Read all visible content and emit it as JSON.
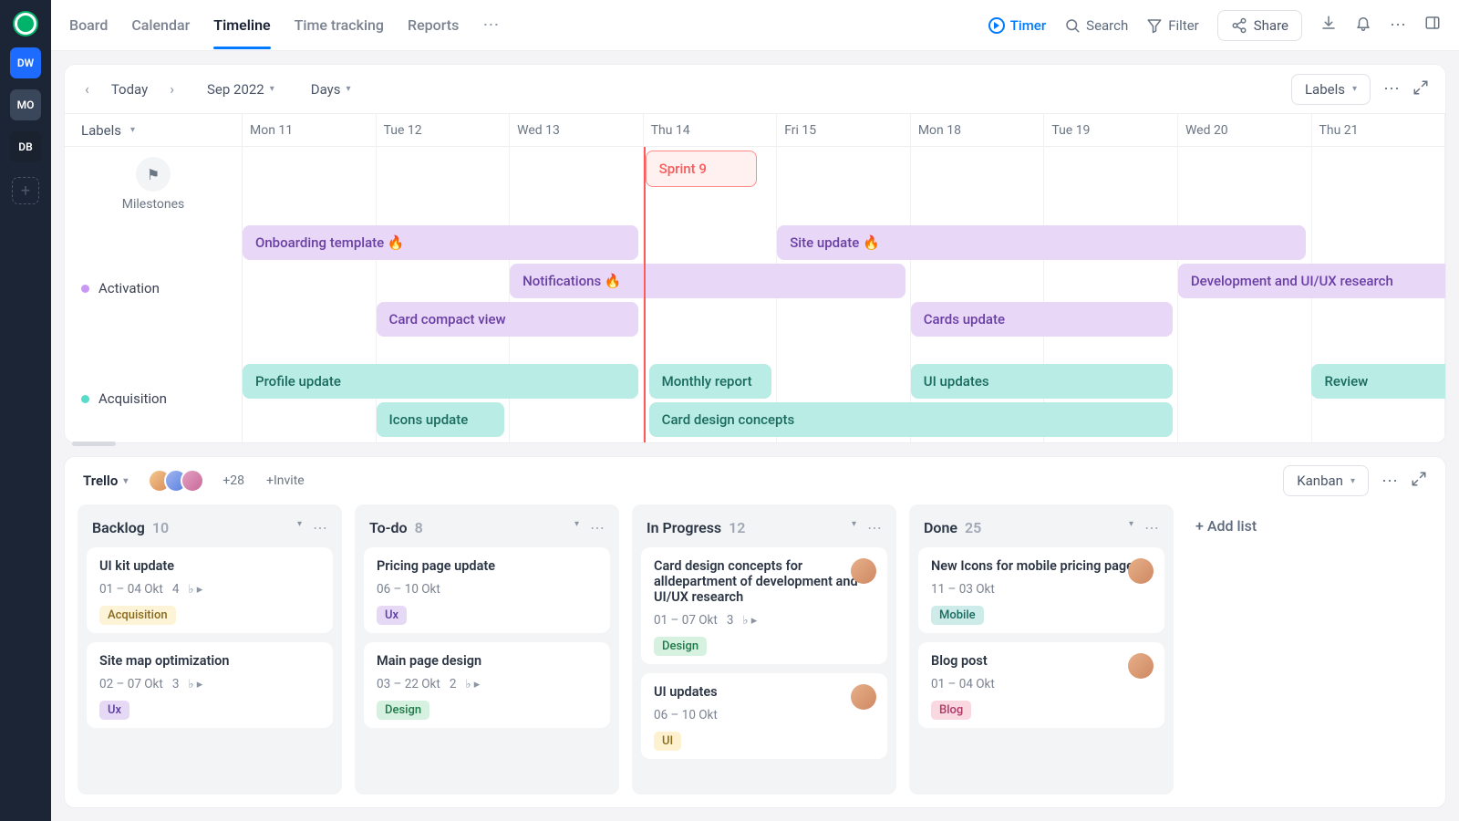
{
  "workspaces": [
    {
      "initials": "DW",
      "color": "#1e6cff"
    },
    {
      "initials": "MO",
      "color": "#3a4659"
    },
    {
      "initials": "DB",
      "color": "#1a2230"
    }
  ],
  "tabs": [
    "Board",
    "Calendar",
    "Timeline",
    "Time tracking",
    "Reports"
  ],
  "active_tab": "Timeline",
  "topbar": {
    "timer": "Timer",
    "search": "Search",
    "filter": "Filter",
    "share": "Share"
  },
  "timeline": {
    "today": "Today",
    "month": "Sep 2022",
    "unit": "Days",
    "labels_btn": "Labels",
    "side_label": "Labels",
    "dates": [
      "Mon 11",
      "Tue 12",
      "Wed 13",
      "Thu 14",
      "Fri 15",
      "Mon 18",
      "Tue 19",
      "Wed 20",
      "Thu 21"
    ],
    "milestones_label": "Milestones",
    "sprint": "Sprint 9",
    "lanes": [
      {
        "name": "Activation",
        "color": "#c998f5"
      },
      {
        "name": "Acquisition",
        "color": "#57dccc"
      }
    ],
    "activation_bars": [
      {
        "label": "Onboarding template 🔥"
      },
      {
        "label": "Site update 🔥"
      },
      {
        "label": "Notifications 🔥"
      },
      {
        "label": "Development and UI/UX research"
      },
      {
        "label": "Card compact view"
      },
      {
        "label": "Cards update"
      }
    ],
    "acquisition_bars": [
      {
        "label": "Profile update"
      },
      {
        "label": "Monthly report"
      },
      {
        "label": "UI updates"
      },
      {
        "label": "Review"
      },
      {
        "label": "Icons update"
      },
      {
        "label": "Card design concepts"
      }
    ]
  },
  "kanban": {
    "title": "Trello",
    "plus_count": "+28",
    "invite": "+Invite",
    "view_btn": "Kanban",
    "add_list": "+ Add list",
    "columns": [
      {
        "title": "Backlog",
        "count": "10",
        "cards": [
          {
            "title": "UI kit update",
            "dates": "01 – 04 Okt",
            "sub": "4",
            "tags": [
              "Acquisition"
            ]
          },
          {
            "title": "Site map optimization",
            "dates": "02 – 07 Okt",
            "sub": "3",
            "tags": [
              "Ux"
            ]
          }
        ]
      },
      {
        "title": "To-do",
        "count": "8",
        "cards": [
          {
            "title": "Pricing page update",
            "dates": "06 – 10 Okt",
            "tags": [
              "Ux"
            ]
          },
          {
            "title": "Main page design",
            "dates": "03 – 22 Okt",
            "sub": "2",
            "tags": [
              "Design"
            ]
          }
        ]
      },
      {
        "title": "In Progress",
        "count": "12",
        "cards": [
          {
            "title": "Card design concepts for alldepartment of development and UI/UX research",
            "dates": "01 – 07 Okt",
            "sub": "3",
            "tags": [
              "Design"
            ],
            "avatar": true
          },
          {
            "title": "UI updates",
            "dates": "06 – 10 Okt",
            "tags": [
              "UI"
            ],
            "avatar": true
          }
        ]
      },
      {
        "title": "Done",
        "count": "25",
        "cards": [
          {
            "title": "New Icons for mobile pricing page",
            "dates": "11 – 03 Okt",
            "tags": [
              "Mobile"
            ],
            "avatar": true
          },
          {
            "title": "Blog post",
            "dates": "01 – 04 Okt",
            "tags": [
              "Blog"
            ],
            "avatar": true
          }
        ]
      }
    ]
  }
}
